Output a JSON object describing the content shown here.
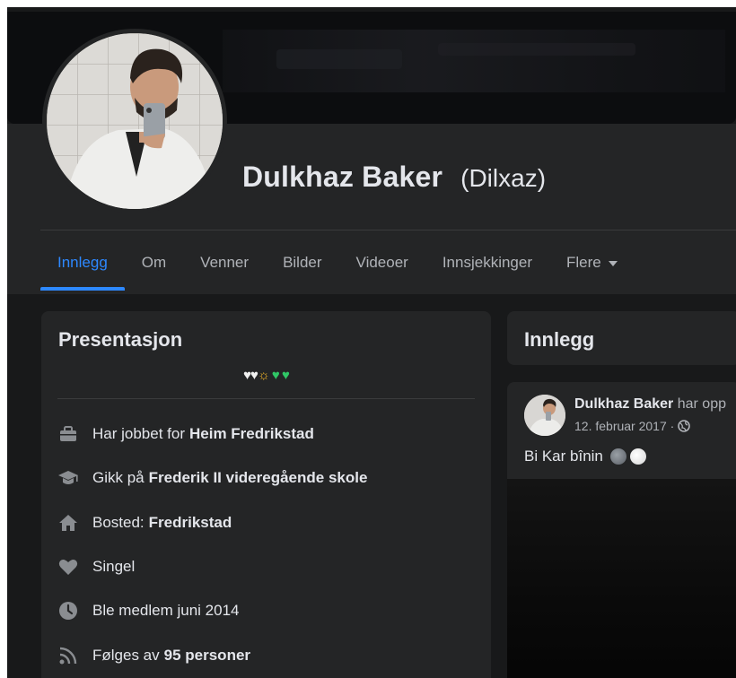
{
  "profile": {
    "name": "Dulkhaz Baker",
    "alternate_name": "(Dilxaz)"
  },
  "tabs": [
    {
      "label": "Innlegg",
      "active": true
    },
    {
      "label": "Om",
      "active": false
    },
    {
      "label": "Venner",
      "active": false
    },
    {
      "label": "Bilder",
      "active": false
    },
    {
      "label": "Videoer",
      "active": false
    },
    {
      "label": "Innsjekkinger",
      "active": false
    },
    {
      "label": "Flere",
      "active": false
    }
  ],
  "intro": {
    "title": "Presentasjon",
    "bio_emoji": [
      "white-heart",
      "white-heart",
      "sun",
      "green-heart",
      "green-heart"
    ],
    "rows": [
      {
        "icon": "briefcase-icon",
        "prefix": "Har jobbet for",
        "bold": "Heim Fredrikstad"
      },
      {
        "icon": "graduation-cap-icon",
        "prefix": "Gikk på",
        "bold": "Frederik II videregående skole"
      },
      {
        "icon": "home-icon",
        "prefix": "Bosted:",
        "bold": "Fredrikstad"
      },
      {
        "icon": "heart-icon",
        "prefix": "Singel",
        "bold": ""
      },
      {
        "icon": "clock-icon",
        "prefix": "Ble medlem juni 2014",
        "bold": ""
      },
      {
        "icon": "rss-icon",
        "prefix": "Følges av",
        "bold": "95 personer"
      }
    ]
  },
  "posts_section": {
    "title": "Innlegg"
  },
  "post": {
    "author": "Dulkhaz Baker",
    "action": "har opp",
    "date": "12. februar 2017 ·",
    "privacy_icon": "globe-icon",
    "text": "Bi Kar bînin"
  },
  "colors": {
    "accent": "#2d88ff",
    "background": "#18191a",
    "card": "#242526"
  }
}
